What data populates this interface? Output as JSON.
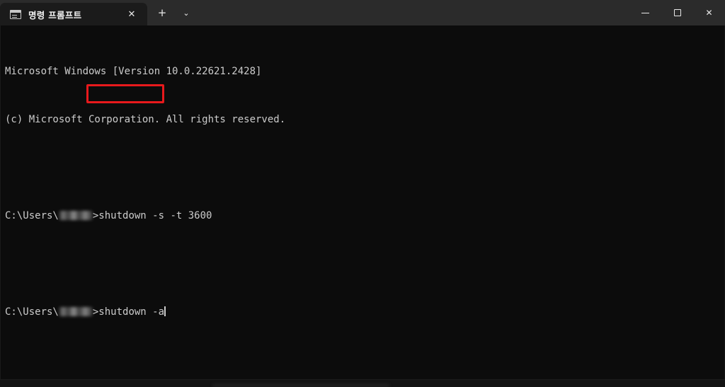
{
  "window": {
    "title": "명령 프롬프트",
    "tab_icon": "console-icon"
  },
  "tabbar": {
    "tab_close_glyph": "✕",
    "new_tab_glyph": "+",
    "dropdown_glyph": "⌄",
    "tabs": [
      {
        "label": "명령 프롬프트",
        "active": true
      }
    ]
  },
  "window_controls": {
    "minimize_glyph": "−",
    "maximize_glyph": "□",
    "close_glyph": "✕"
  },
  "terminal": {
    "banner": [
      "Microsoft Windows [Version 10.0.22621.2428]",
      "(c) Microsoft Corporation. All rights reserved."
    ],
    "prompt_prefix": "C:\\Users\\",
    "prompt_suffix": ">",
    "lines": [
      {
        "type": "command",
        "prefix": "C:\\Users\\",
        "user_redacted": true,
        "suffix": ">",
        "command": "shutdown -s -t 3600",
        "highlighted": false,
        "cursor": false
      },
      {
        "type": "command",
        "prefix": "C:\\Users\\",
        "user_redacted": true,
        "suffix": ">",
        "command": "shutdown -a",
        "highlighted": true,
        "cursor": true
      }
    ]
  },
  "colors": {
    "titlebar_bg": "#2b2b2b",
    "tab_active_bg": "#1b1b1b",
    "terminal_bg": "#0c0c0c",
    "terminal_fg": "#cccccc",
    "highlight_red": "#e8191c"
  }
}
